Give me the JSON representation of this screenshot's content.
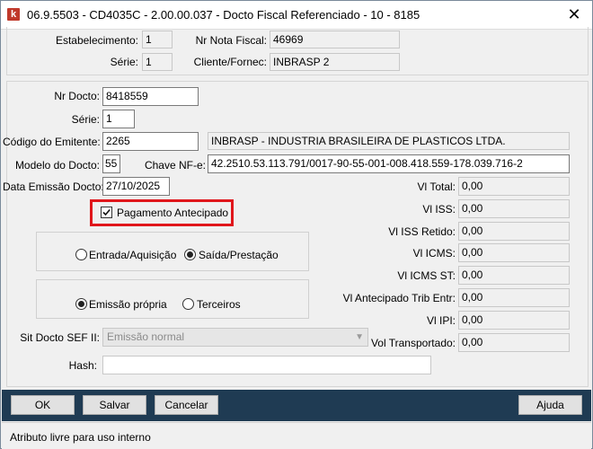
{
  "window": {
    "icon_letter": "k",
    "title": "06.9.5503 - CD4035C - 2.00.00.037 - Docto Fiscal Referenciado - 10 - 8185",
    "close_glyph": "✕"
  },
  "header": {
    "estabelecimento_label": "Estabelecimento:",
    "estabelecimento_value": "1",
    "serie_label": "Série:",
    "serie_value": "1",
    "nr_nota_fiscal_label": "Nr Nota Fiscal:",
    "nr_nota_fiscal_value": "46969",
    "cliente_fornec_label": "Cliente/Fornec:",
    "cliente_fornec_value": "INBRASP  2"
  },
  "form": {
    "nr_docto_label": "Nr Docto:",
    "nr_docto_value": "8418559",
    "serie_label": "Série:",
    "serie_value": "1",
    "codigo_emitente_label": "Código do Emitente:",
    "codigo_emitente_value": "2265",
    "emitente_nome": "INBRASP - INDUSTRIA BRASILEIRA DE PLASTICOS LTDA.",
    "modelo_docto_label": "Modelo do Docto:",
    "modelo_docto_value": "55",
    "chave_nfe_label": "Chave NF-e:",
    "chave_nfe_value": "42.2510.53.113.791/0017-90-55-001-008.418.559-178.039.716-2",
    "data_emissao_label": "Data Emissão Docto:",
    "data_emissao_value": "27/10/2025",
    "pagamento_antecipado_label": "Pagamento Antecipado",
    "pagamento_antecipado_checked": true,
    "tipo_operacao": {
      "options": [
        "Entrada/Aquisição",
        "Saída/Prestação"
      ],
      "selected": "Saída/Prestação"
    },
    "emissao": {
      "options": [
        "Emissão própria",
        "Terceiros"
      ],
      "selected": "Emissão própria"
    },
    "sit_docto_label": "Sit Docto SEF II:",
    "sit_docto_value": "Emissão normal",
    "hash_label": "Hash:",
    "hash_value": ""
  },
  "valores": [
    {
      "label": "Vl Total:",
      "value": "0,00"
    },
    {
      "label": "Vl ISS:",
      "value": "0,00"
    },
    {
      "label": "Vl ISS Retido:",
      "value": "0,00"
    },
    {
      "label": "Vl ICMS:",
      "value": "0,00"
    },
    {
      "label": "Vl ICMS ST:",
      "value": "0,00"
    },
    {
      "label": "Vl Antecipado Trib Entr:",
      "value": "0,00"
    },
    {
      "label": "Vl IPI:",
      "value": "0,00"
    },
    {
      "label": "Vol Transportado:",
      "value": "0,00"
    }
  ],
  "buttons": {
    "ok": "OK",
    "salvar": "Salvar",
    "cancelar": "Cancelar",
    "ajuda": "Ajuda"
  },
  "status": {
    "text": "Atributo livre para uso interno"
  },
  "colors": {
    "highlight": "#e0161b",
    "bottom_bar": "#1f3b53"
  }
}
